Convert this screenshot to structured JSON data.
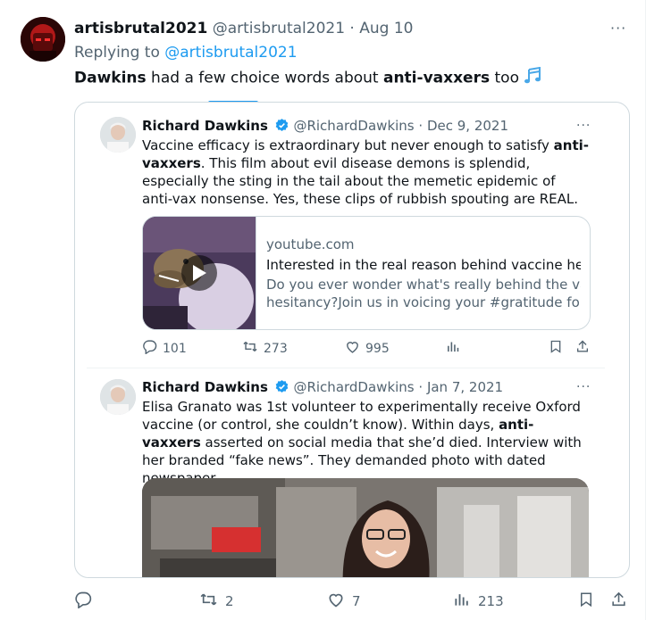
{
  "tweet": {
    "display_name": "artisbrutal2021",
    "handle": "@artisbrutal2021",
    "date": "· Aug 10",
    "replying_prefix": "Replying to",
    "replying_to": "@artisbrutal2021",
    "text_bold_1": "Dawkins",
    "text_1": " had a few choice words about ",
    "text_bold_2": "anti-vaxxers",
    "text_2": " too",
    "more_label": "···",
    "stats": {
      "replies": "",
      "retweets": "2",
      "likes": "7",
      "views": "213"
    }
  },
  "quoted": [
    {
      "display_name": "Richard Dawkins",
      "handle": "@RichardDawkins",
      "date": "· Dec 9, 2021",
      "text_1": "Vaccine efficacy is extraordinary but never enough to satisfy ",
      "text_bold": "anti-vaxxers",
      "text_2": ". This film about evil disease demons is splendid, especially the sting in the tail about the memetic epidemic of anti-vax nonsense. Yes, these clips of rubbish spouting are REAL.",
      "card": {
        "domain": "youtube.com",
        "title": "Interested in the real reason behind vaccine hesitancy?",
        "desc_line1": "Do you ever wonder what's really behind the vaccine",
        "desc_line2": "hesitancy?Join us in voicing your #gratitude for the ..."
      },
      "stats": {
        "replies": "101",
        "retweets": "273",
        "likes": "995"
      }
    },
    {
      "display_name": "Richard Dawkins",
      "handle": "@RichardDawkins",
      "date": "· Jan 7, 2021",
      "text_1": "Elisa Granato was 1st volunteer to experimentally receive Oxford vaccine (or control, she couldn’t know). Within days, ",
      "text_bold": "anti-vaxxers",
      "text_2": " asserted on social media that she’d died. Interview with her branded “fake news”. They demanded photo with dated newspaper"
    }
  ],
  "colors": {
    "accent": "#1d9bf0",
    "muted": "#536471",
    "border": "#cfd9de"
  }
}
